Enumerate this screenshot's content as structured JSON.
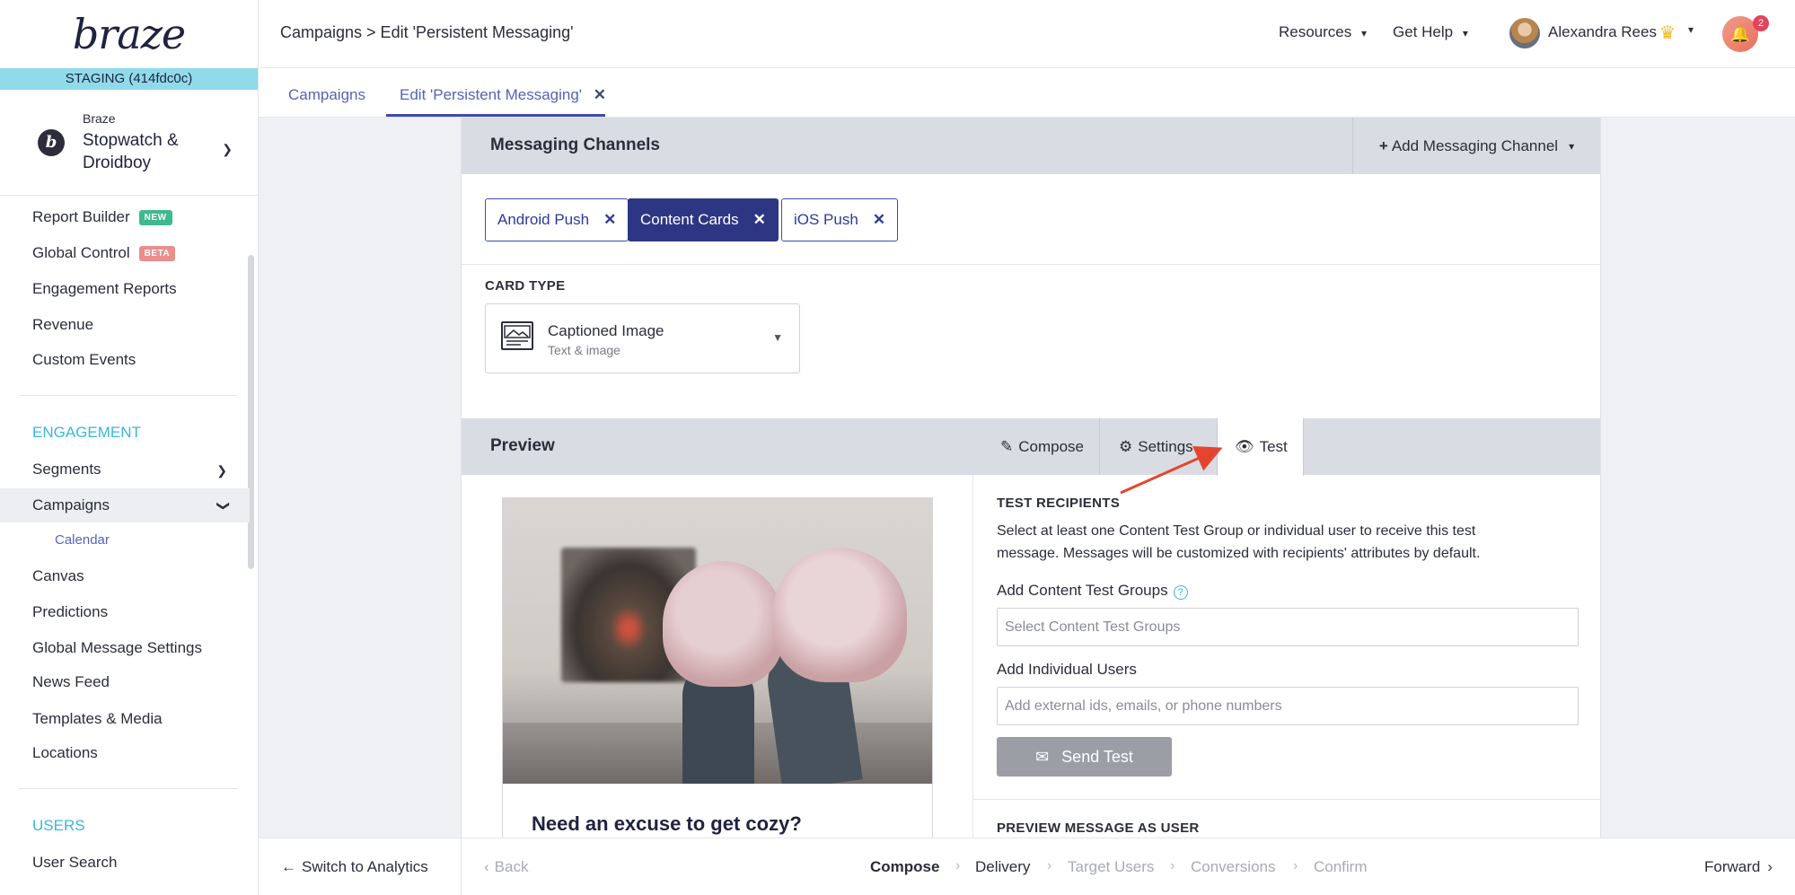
{
  "brand": {
    "logo": "braze",
    "env_banner": "STAGING (414fdc0c)"
  },
  "company": {
    "org": "Braze",
    "workspace": "Stopwatch & Droidboy"
  },
  "sidebar": {
    "items_top": [
      {
        "label": "Report Builder",
        "badge": "NEW"
      },
      {
        "label": "Global Control",
        "badge": "BETA"
      },
      {
        "label": "Engagement Reports"
      },
      {
        "label": "Revenue"
      },
      {
        "label": "Custom Events"
      }
    ],
    "engagement_heading": "ENGAGEMENT",
    "engagement_items": [
      {
        "label": "Segments"
      },
      {
        "label": "Campaigns"
      },
      {
        "label": "Calendar"
      },
      {
        "label": "Canvas"
      },
      {
        "label": "Predictions"
      },
      {
        "label": "Global Message Settings"
      },
      {
        "label": "News Feed"
      },
      {
        "label": "Templates & Media"
      },
      {
        "label": "Locations"
      }
    ],
    "users_heading": "USERS",
    "users_items": [
      {
        "label": "User Search"
      }
    ]
  },
  "header": {
    "breadcrumb": "Campaigns > Edit 'Persistent Messaging'",
    "resources": "Resources",
    "help": "Get Help",
    "user_name": "Alexandra Rees",
    "notification_count": "2"
  },
  "tabs": [
    {
      "label": "Campaigns"
    },
    {
      "label": "Edit 'Persistent Messaging'"
    }
  ],
  "channels": {
    "title": "Messaging Channels",
    "add_label": "Add Messaging Channel",
    "chips": [
      {
        "label": "Android Push"
      },
      {
        "label": "Content Cards"
      },
      {
        "label": "iOS Push"
      }
    ]
  },
  "card_type": {
    "label": "CARD TYPE",
    "selected": "Captioned Image",
    "description": "Text & image"
  },
  "preview": {
    "title": "Preview",
    "tabs": [
      {
        "label": "Compose"
      },
      {
        "label": "Settings"
      },
      {
        "label": "Test"
      }
    ],
    "card_headline": "Need an excuse to get cozy?"
  },
  "test": {
    "heading": "TEST RECIPIENTS",
    "description_line1": "Select at least one Content Test Group or individual user to receive this test",
    "description_line2": "message. Messages will be customized with recipients' attributes by default.",
    "groups_label": "Add Content Test Groups",
    "groups_placeholder": "Select Content Test Groups",
    "users_label": "Add Individual Users",
    "users_placeholder": "Add external ids, emails, or phone numbers",
    "send_label": "Send Test",
    "preview_as_user": "PREVIEW MESSAGE AS USER"
  },
  "footer": {
    "switch": "Switch to Analytics",
    "back": "Back",
    "steps": [
      "Compose",
      "Delivery",
      "Target Users",
      "Conversions",
      "Confirm"
    ],
    "forward": "Forward"
  },
  "colors": {
    "accent": "#3f4bb0",
    "staging": "#8fdbea",
    "active_chip": "#2d3683",
    "arrow": "#e5452f"
  }
}
